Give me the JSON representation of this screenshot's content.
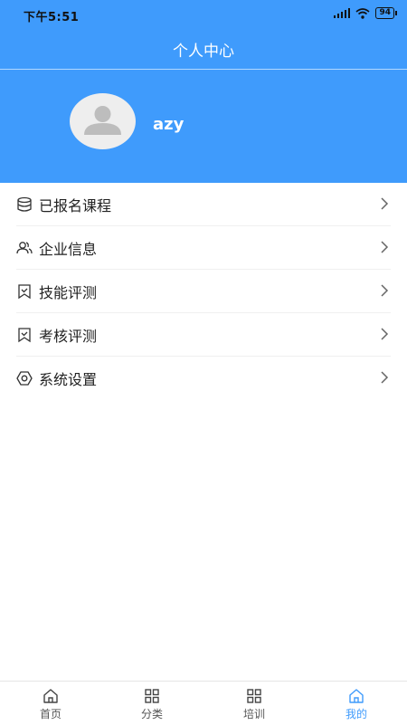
{
  "status_bar": {
    "time": "下午5:51",
    "battery": "94"
  },
  "header": {
    "title": "个人中心"
  },
  "profile": {
    "username": "azy"
  },
  "menu": [
    {
      "label": "已报名课程",
      "icon": "database-icon"
    },
    {
      "label": "企业信息",
      "icon": "users-icon"
    },
    {
      "label": "技能评测",
      "icon": "bookmark-icon"
    },
    {
      "label": "考核评测",
      "icon": "bookmark-icon"
    },
    {
      "label": "系统设置",
      "icon": "gear-icon"
    }
  ],
  "tabs": [
    {
      "label": "首页",
      "icon": "home-icon"
    },
    {
      "label": "分类",
      "icon": "grid-icon"
    },
    {
      "label": "培训",
      "icon": "grid-icon"
    },
    {
      "label": "我的",
      "icon": "home-icon",
      "active": true
    }
  ],
  "colors": {
    "primary": "#3f9bfc"
  }
}
